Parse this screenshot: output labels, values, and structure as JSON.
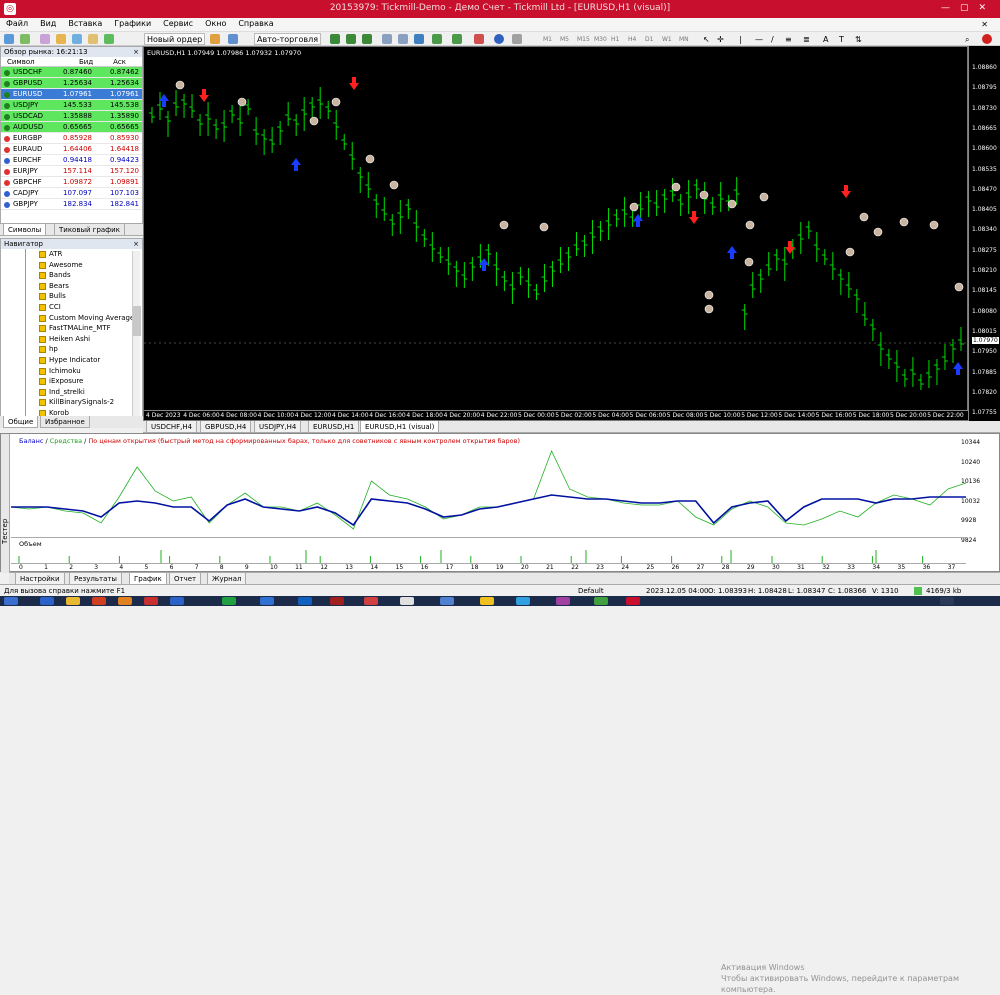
{
  "window": {
    "title": "20153979: Tickmill-Demo - Демо Счет - Tickmill Ltd - [EURUSD,H1 (visual)]"
  },
  "menu": [
    "Файл",
    "Вид",
    "Вставка",
    "Графики",
    "Сервис",
    "Окно",
    "Справка"
  ],
  "toolbar": {
    "new_order": "Новый ордер",
    "autotrade": "Авто-торговля",
    "timeframes": [
      "M1",
      "M5",
      "M15",
      "M30",
      "H1",
      "H4",
      "D1",
      "W1",
      "MN"
    ]
  },
  "market_watch": {
    "title": "Обзор рынка: 16:21:13",
    "col_symbol": "Символ",
    "col_bid": "Бид",
    "col_ask": "Аск",
    "rows": [
      {
        "sym": "USDCHF",
        "bid": "0.87460",
        "ask": "0.87462",
        "style": "g"
      },
      {
        "sym": "GBPUSD",
        "bid": "1.25634",
        "ask": "1.25634",
        "style": "g"
      },
      {
        "sym": "EURUSD",
        "bid": "1.07961",
        "ask": "1.07961",
        "style": "sel"
      },
      {
        "sym": "USDJPY",
        "bid": "145.533",
        "ask": "145.538",
        "style": "g"
      },
      {
        "sym": "USDCAD",
        "bid": "1.35888",
        "ask": "1.35890",
        "style": "g"
      },
      {
        "sym": "AUDUSD",
        "bid": "0.65665",
        "ask": "0.65665",
        "style": "g"
      },
      {
        "sym": "EURGBP",
        "bid": "0.85928",
        "ask": "0.85930",
        "style": "r"
      },
      {
        "sym": "EURAUD",
        "bid": "1.64406",
        "ask": "1.64418",
        "style": "r"
      },
      {
        "sym": "EURCHF",
        "bid": "0.94418",
        "ask": "0.94423",
        "style": "b"
      },
      {
        "sym": "EURJPY",
        "bid": "157.114",
        "ask": "157.120",
        "style": "r"
      },
      {
        "sym": "GBPCHF",
        "bid": "1.09872",
        "ask": "1.09891",
        "style": "r"
      },
      {
        "sym": "CADJPY",
        "bid": "107.097",
        "ask": "107.103",
        "style": "b"
      },
      {
        "sym": "GBPJPY",
        "bid": "182.834",
        "ask": "182.841",
        "style": "b"
      }
    ],
    "tabs": [
      "Символы",
      "Тиковый график"
    ]
  },
  "navigator": {
    "title": "Навигатор",
    "items": [
      "ATR",
      "Awesome",
      "Bands",
      "Bears",
      "Bulls",
      "CCI",
      "Custom Moving Averages",
      "FastTMALine_MTF",
      "Heiken Ashi",
      "hp",
      "Hype Indicator",
      "Ichimoku",
      "iExposure",
      "Ind_strelki",
      "KillBinarySignals-2",
      "Korob"
    ],
    "tabs": [
      "Общие",
      "Избранное"
    ]
  },
  "chart": {
    "label": "EURUSD,H1  1.07949 1.07986 1.07932 1.07970",
    "price_labels": [
      "1.08860",
      "1.08795",
      "1.08730",
      "1.08665",
      "1.08600",
      "1.08535",
      "1.08470",
      "1.08405",
      "1.08340",
      "1.08275",
      "1.08210",
      "1.08145",
      "1.08080",
      "1.08015",
      "1.07950",
      "1.07885",
      "1.07820",
      "1.07755"
    ],
    "current_price": "1.07970",
    "time_labels": [
      "4 Dec 2023",
      "4 Dec 06:00",
      "4 Dec 08:00",
      "4 Dec 10:00",
      "4 Dec 12:00",
      "4 Dec 14:00",
      "4 Dec 16:00",
      "4 Dec 18:00",
      "4 Dec 20:00",
      "4 Dec 22:00",
      "5 Dec 00:00",
      "5 Dec 02:00",
      "5 Dec 04:00",
      "5 Dec 06:00",
      "5 Dec 08:00",
      "5 Dec 10:00",
      "5 Dec 12:00",
      "5 Dec 14:00",
      "5 Dec 16:00",
      "5 Dec 18:00",
      "5 Dec 20:00",
      "5 Dec 22:00"
    ],
    "tabs": [
      "USDCHF,H4",
      "GBPUSD,H4",
      "USDJPY,H4",
      "EURUSD,H1",
      "EURUSD,H1 (visual)"
    ],
    "colors": {
      "bar": "#00e000",
      "up_arrow": "#1a3cff",
      "down_arrow": "#ff2020",
      "marker": "#c8b4a0"
    }
  },
  "tester": {
    "side_label": "Тестер",
    "legend_balance": "Баланс",
    "legend_equity": "Средства",
    "legend_note": "По ценам открытия (быстрый метод на сформированных барах, только для советников с явным контролем открытия баров)",
    "y_labels": [
      "10344",
      "10240",
      "10136",
      "10032",
      "9928",
      "9824"
    ],
    "volume_title": "Объем",
    "x_labels": [
      "0",
      "1",
      "2",
      "3",
      "4",
      "5",
      "6",
      "7",
      "8",
      "9",
      "10",
      "11",
      "12",
      "13",
      "14",
      "15",
      "16",
      "17",
      "18",
      "19",
      "20",
      "21",
      "22",
      "23",
      "24",
      "25",
      "26",
      "27",
      "28",
      "29",
      "30",
      "31",
      "32",
      "33",
      "34",
      "35",
      "36",
      "37"
    ],
    "tabs": [
      "Настройки",
      "Результаты",
      "График",
      "Отчет",
      "Журнал"
    ],
    "watermark": [
      "Активация Windows",
      "Чтобы активировать Windows, перейдите к параметрам",
      "компьютера."
    ]
  },
  "status": {
    "help": "Для вызова справки нажмите F1",
    "profile": "Default",
    "time": "2023.12.05 04:00",
    "open": "O: 1.08393",
    "high": "H: 1.08428",
    "low": "L: 1.08347",
    "close": "C: 1.08366",
    "volume": "V: 1310",
    "traffic": "4169/3 kb"
  }
}
